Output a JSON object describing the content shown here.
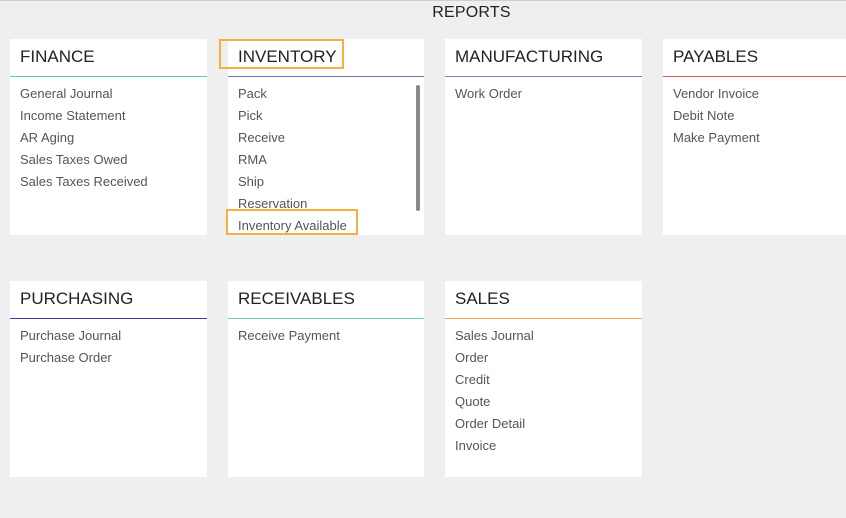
{
  "page": {
    "title": "REPORTS"
  },
  "cards": [
    {
      "id": "finance",
      "title": "FINANCE",
      "accent": "#5fc8b8",
      "items": [
        "General Journal",
        "Income Statement",
        "AR Aging",
        "Sales Taxes Owed",
        "Sales Taxes Received"
      ]
    },
    {
      "id": "inventory",
      "title": "INVENTORY",
      "accent": "#7b6fb0",
      "items": [
        "Pack",
        "Pick",
        "Receive",
        "RMA",
        "Ship",
        "Reservation",
        "Inventory Available"
      ]
    },
    {
      "id": "manufacturing",
      "title": "MANUFACTURING",
      "accent": "#7c7fd1",
      "items": [
        "Work Order"
      ]
    },
    {
      "id": "payables",
      "title": "PAYABLES",
      "accent": "#d9534f",
      "items": [
        "Vendor Invoice",
        "Debit Note",
        "Make Payment"
      ]
    },
    {
      "id": "purchasing",
      "title": "PURCHASING",
      "accent": "#3c3f9a",
      "items": [
        "Purchase Journal",
        "Purchase Order"
      ]
    },
    {
      "id": "receivables",
      "title": "RECEIVABLES",
      "accent": "#6fcf9f",
      "items": [
        "Receive Payment"
      ]
    },
    {
      "id": "sales",
      "title": "SALES",
      "accent": "#f0a24a",
      "items": [
        "Sales Journal",
        "Order",
        "Credit",
        "Quote",
        "Order Detail",
        "Invoice"
      ]
    }
  ],
  "highlight_color": "#f5b042"
}
